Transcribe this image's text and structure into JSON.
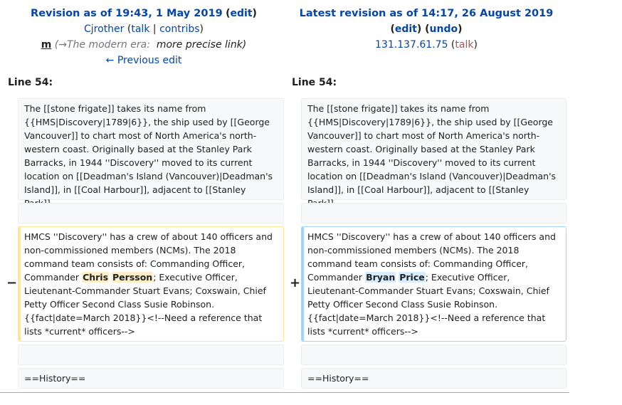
{
  "left_header": {
    "title": "Revision as of 19:43, 1 May 2019",
    "edit": "edit",
    "user": "Cjrother",
    "talk": "talk",
    "contribs": "contribs",
    "minor": "m",
    "summary_arrow": "(→",
    "summary_section": "The modern era:",
    "summary_text": "more precise link)",
    "prev": "← Previous edit"
  },
  "right_header": {
    "title": "Latest revision as of 14:17, 26 August 2019",
    "edit": "edit",
    "undo": "undo",
    "user": "131.137.61.75",
    "talk": "talk"
  },
  "line_left": "Line 54:",
  "line_right": "Line 54:",
  "context_text": "The [[stone frigate]] takes its name from {{HMS|Discovery|1789|6}}, the ship used by [[George Vancouver]] to chart most of North America's north-western coast. Originally based at the Stanley Park Barracks, in 1944 ''Discovery'' moved to its current location on [[Deadman's Island (Vancouver)|Deadman's Island]], in [[Coal Harbour]], adjacent to [[Stanley Park]].",
  "deleted": {
    "before": "HMCS ''Discovery'' has a crew of about 140 officers and non-commissioned members (NCMs). The 2018 command team consists of: Commanding Officer, Commander ",
    "hl1": "Chris",
    "hl2": "Persson",
    "after": "; Executive Officer, Lieutenant-Commander Stuart Evans; Coxswain, Chief Petty Officer Second Class Susie Robinson. {{fact|date=March 2018}}<!--Need a reference that lists *current* officers-->",
    "marker": "−"
  },
  "added": {
    "before": "HMCS ''Discovery'' has a crew of about 140 officers and non-commissioned members (NCMs). The 2018 command team consists of: Commanding Officer, Commander ",
    "hl1": "Bryan",
    "hl2": "Price",
    "after": "; Executive Officer, Lieutenant-Commander Stuart Evans; Coxswain, Chief Petty Officer Second Class Susie Robinson.{{fact|date=March 2018}}<!--Need a reference that lists *current* officers-->",
    "marker": "+"
  },
  "history_text": "==History==",
  "colors": {
    "link": "#0645ad",
    "deleted_border": "#ffe49c",
    "added_border": "#a3d3ff",
    "deleted_hl": "#feeec8",
    "added_hl": "#d8ecff"
  }
}
